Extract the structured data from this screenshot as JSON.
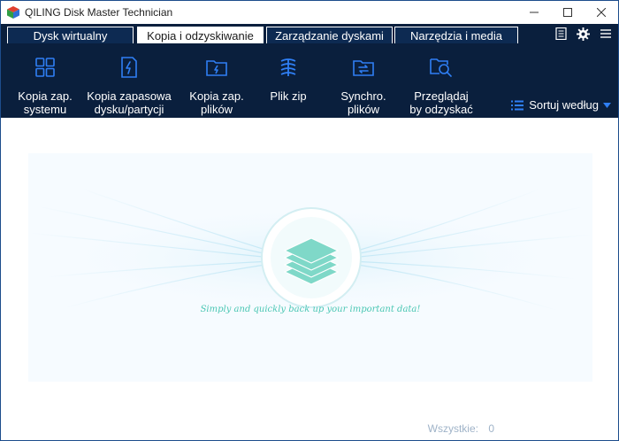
{
  "window": {
    "title": "QILING Disk Master Technician",
    "minimize_icon": "minimize-icon",
    "maximize_icon": "maximize-icon",
    "close_icon": "close-icon"
  },
  "tabs": [
    {
      "label": "Dysk wirtualny",
      "active": false
    },
    {
      "label": "Kopia i odzyskiwanie",
      "active": true
    },
    {
      "label": "Zarządzanie dyskami",
      "active": false
    },
    {
      "label": "Narzędzia i media",
      "active": false
    }
  ],
  "top_icons": [
    "log-icon",
    "gear-icon",
    "menu-icon"
  ],
  "toolbar": {
    "items": [
      {
        "label": "Kopia zap.\nsystemu",
        "icon": "system-backup-icon"
      },
      {
        "label": "Kopia zapasowa\ndysku/partycji",
        "icon": "disk-backup-icon"
      },
      {
        "label": "Kopia zap.\nplików",
        "icon": "file-backup-icon"
      },
      {
        "label": "Plik zip",
        "icon": "zip-icon"
      },
      {
        "label": "Synchro.\nplików",
        "icon": "file-sync-icon"
      },
      {
        "label": "Przeglądaj\nby odzyskać",
        "icon": "browse-recover-icon"
      }
    ],
    "sort_label": "Sortuj według"
  },
  "content": {
    "tagline": "Simply and quickly back up your important data!",
    "footer_label": "Wszystkie:",
    "footer_count": "0"
  },
  "colors": {
    "toolbar_bg": "#0a1f3d",
    "accent_blue": "#2f7ff5",
    "teal": "#4cc7b4"
  }
}
